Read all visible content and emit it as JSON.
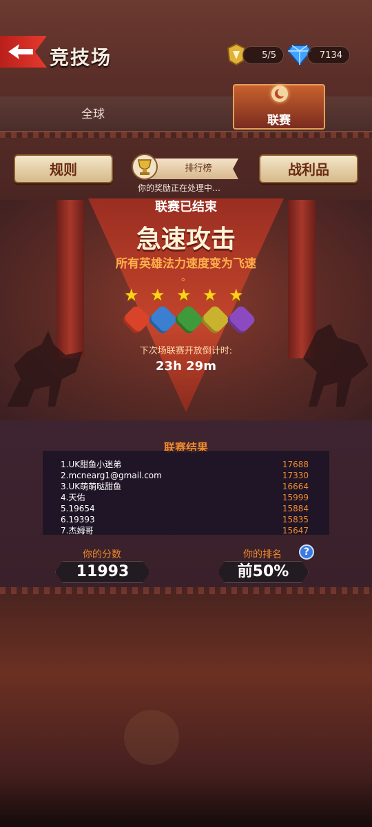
{
  "header": {
    "title": "竞技场",
    "stamina": "5/5",
    "gems": "7134"
  },
  "tabs": [
    {
      "label": "全球",
      "active": false
    },
    {
      "label": "联赛",
      "active": true
    }
  ],
  "buttons": {
    "rules": "规则",
    "leaderboard": "排行榜",
    "rewards": "战利品"
  },
  "reward_status": "你的奖励正在处理中…",
  "league": {
    "status": "联赛已结束",
    "mode_title": "急速攻击",
    "mode_desc": "所有英雄法力速度变为飞速",
    "mode_desc_end": "。",
    "stars": 5,
    "elements": [
      {
        "icon": "fire-element-icon",
        "color": "#d9432a"
      },
      {
        "icon": "ice-element-icon",
        "color": "#3a7fd0"
      },
      {
        "icon": "nature-element-icon",
        "color": "#3e9a3a"
      },
      {
        "icon": "holy-element-icon",
        "color": "#c8b22e"
      },
      {
        "icon": "dark-element-icon",
        "color": "#8b4ac0"
      }
    ],
    "countdown_label": "下次场联赛开放倒计时:",
    "countdown": "23h 29m"
  },
  "results": {
    "title": "联赛结果",
    "rows": [
      {
        "name": "1.UK甜鱼小迷弟",
        "score": "17688"
      },
      {
        "name": "2.mcnearg1@gmail.com",
        "score": "17330"
      },
      {
        "name": "3.UK萌萌哒甜鱼",
        "score": "16664"
      },
      {
        "name": "4.天佑",
        "score": "15999"
      },
      {
        "name": "5.19654",
        "score": "15884"
      },
      {
        "name": "6.19393",
        "score": "15835"
      },
      {
        "name": "7.杰姆哥",
        "score": "15647"
      }
    ]
  },
  "your_score": {
    "label": "你的分数",
    "value": "11993"
  },
  "your_rank": {
    "label": "你的排名",
    "value": "前50%"
  },
  "colors": {
    "accent_orange": "#f08a2c",
    "gold": "#ffd21a",
    "back_red": "#e7392e"
  }
}
